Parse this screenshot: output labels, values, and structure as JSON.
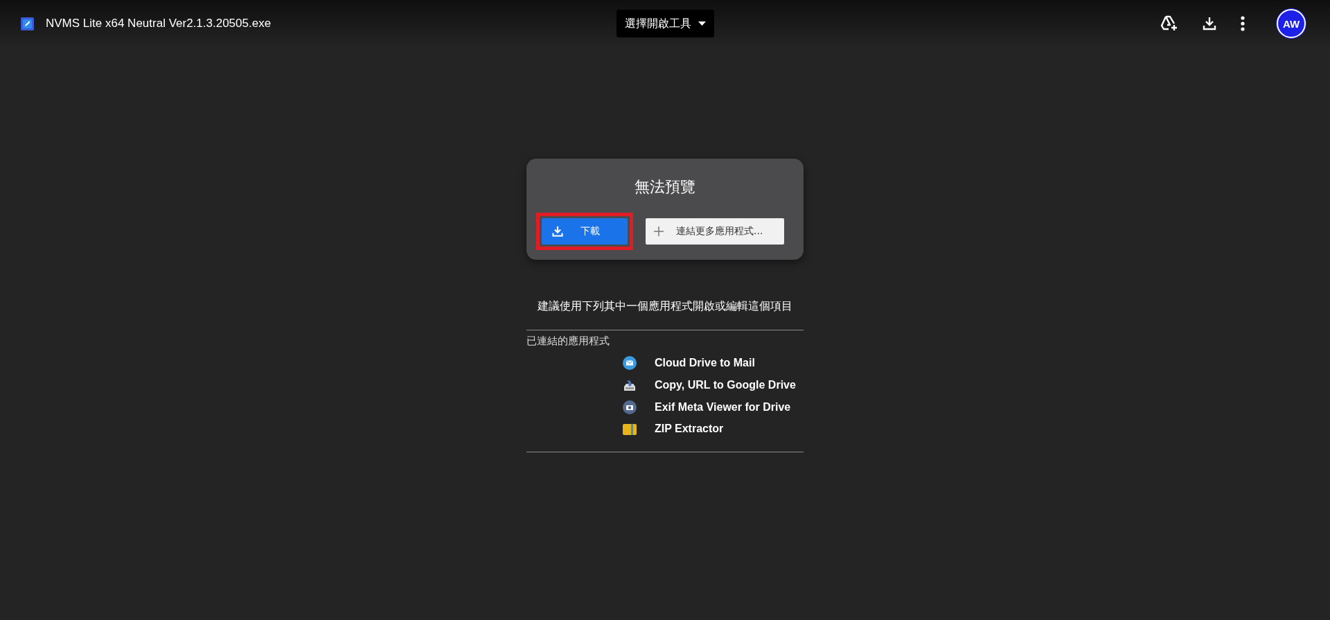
{
  "header": {
    "file_name": "NVMS Lite x64 Neutral Ver2.1.3.20505.exe",
    "open_with": "選擇開啟工具",
    "avatar": "AW"
  },
  "preview": {
    "title": "無法預覽",
    "download": {
      "label": "下載",
      "highlighted": true
    },
    "connect": {
      "label": "連結更多應用程式..."
    }
  },
  "suggestion": "建議使用下列其中一個應用程式開啟或編輯這個項目",
  "connected_apps": {
    "heading": "已連結的應用程式",
    "items": [
      {
        "kind": "mail",
        "name": "Cloud Drive to Mail"
      },
      {
        "kind": "copy",
        "name": "Copy, URL to Google Drive"
      },
      {
        "kind": "camera",
        "name": "Exif Meta Viewer for Drive"
      },
      {
        "kind": "zip",
        "name": "ZIP Extractor"
      }
    ]
  }
}
